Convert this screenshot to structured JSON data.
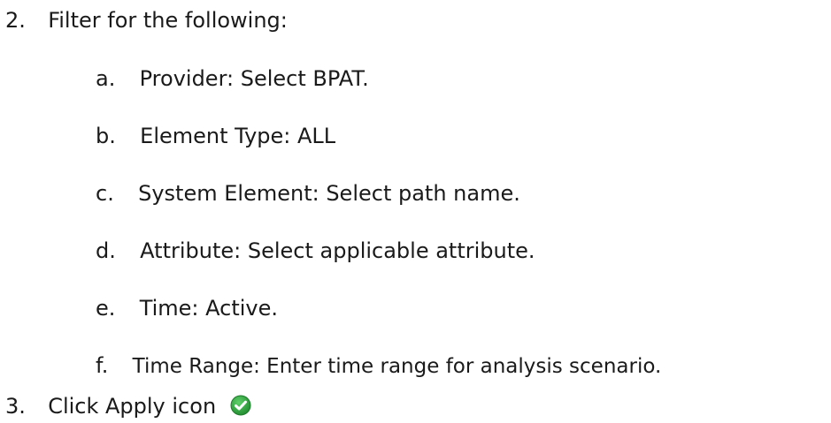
{
  "steps": [
    {
      "number": "2.",
      "text": "Filter for the following:",
      "substeps": [
        {
          "letter": "a.",
          "text": "Provider:  Select BPAT."
        },
        {
          "letter": "b.",
          "text": "Element Type:  ALL"
        },
        {
          "letter": "c.",
          "text": "System Element:  Select path name."
        },
        {
          "letter": "d.",
          "text": "Attribute:  Select applicable attribute."
        },
        {
          "letter": "e.",
          "text": "Time:  Active."
        },
        {
          "letter": "f.",
          "text": "Time Range:  Enter time range for analysis scenario."
        }
      ]
    },
    {
      "number": "3.",
      "text": "Click Apply icon",
      "icon": "apply-checkmark-icon"
    }
  ],
  "colors": {
    "text": "#1a1a1a",
    "apply_icon_fill": "#2e9e3e",
    "apply_icon_check": "#ffffff"
  }
}
